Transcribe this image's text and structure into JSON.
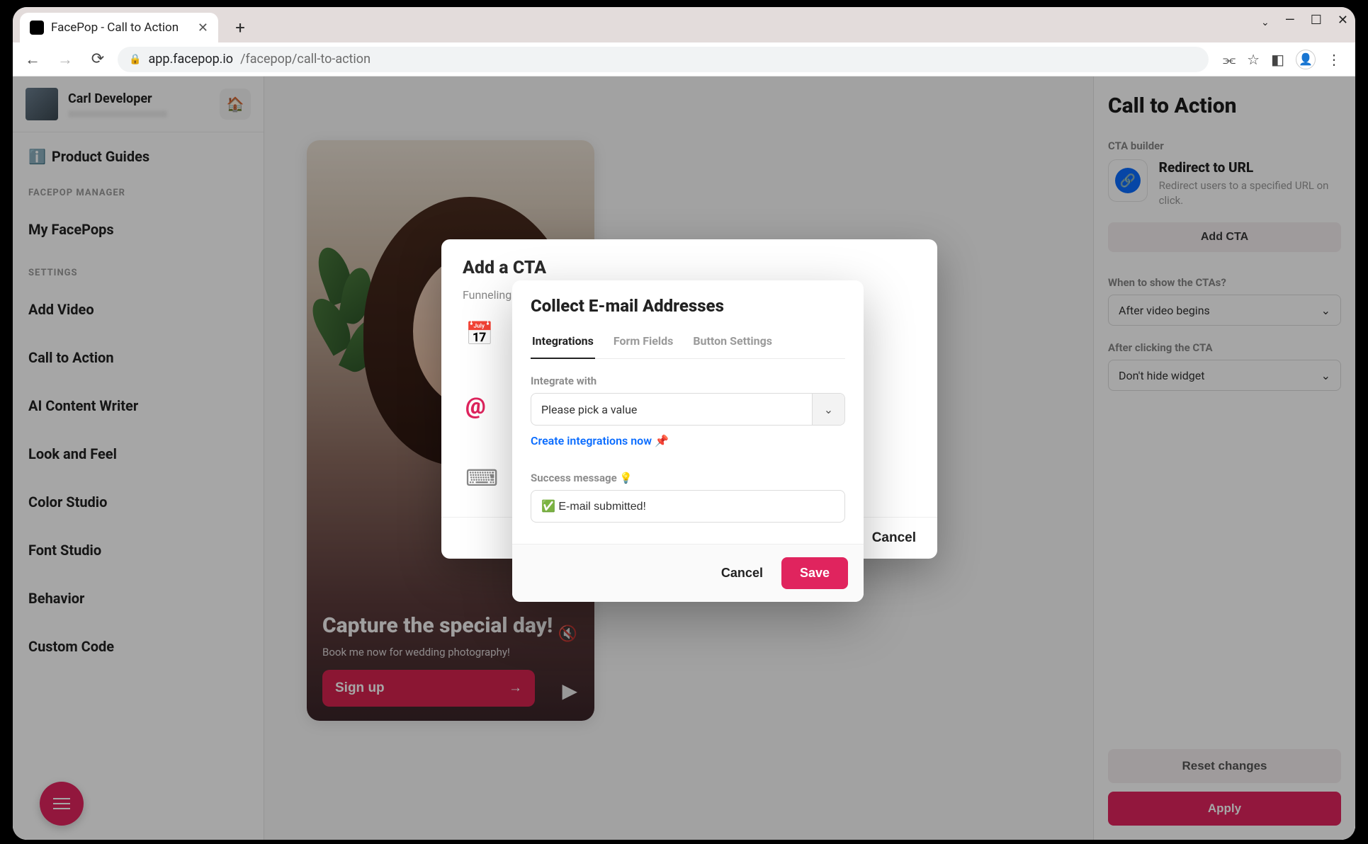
{
  "browser": {
    "tab_title": "FacePop - Call to Action",
    "url_host": "app.facepop.io",
    "url_path": "/facepop/call-to-action"
  },
  "sidebar": {
    "user_name": "Carl Developer",
    "product_guides_label": "Product Guides",
    "product_guides_icon": "ℹ️",
    "section_manager": "FACEPOP MANAGER",
    "my_facepops": "My FacePops",
    "section_settings": "SETTINGS",
    "items": [
      "Add Video",
      "Call to Action",
      "AI Content Writer",
      "Look and Feel",
      "Color Studio",
      "Font Studio",
      "Behavior",
      "Custom Code"
    ]
  },
  "preview": {
    "title": "Capture the special day!",
    "subtitle": "Book me now for wedding photography!",
    "signup_label": "Sign up"
  },
  "right_panel": {
    "title": "Call to Action",
    "builder_label": "CTA builder",
    "cta_title": "Redirect to URL",
    "cta_sub": "Redirect users to a specified URL on click.",
    "add_cta": "Add CTA",
    "when_label": "When to show the CTAs?",
    "when_value": "After video begins",
    "after_label": "After clicking the CTA",
    "after_value": "Don't hide widget",
    "reset": "Reset changes",
    "apply": "Apply"
  },
  "outer_modal": {
    "title": "Add a CTA",
    "subtitle": "Funneling",
    "cancel": "Cancel",
    "icons": [
      "📅",
      "@",
      "⌨"
    ]
  },
  "inner_modal": {
    "title": "Collect E-mail Addresses",
    "tabs": [
      "Integrations",
      "Form Fields",
      "Button Settings"
    ],
    "active_tab_index": 0,
    "integrate_label": "Integrate with",
    "integrate_placeholder": "Please pick a value",
    "create_link": "Create integrations now",
    "create_link_icon": "📌",
    "success_label": "Success message 💡",
    "success_value": "✅ E-mail submitted!",
    "cancel": "Cancel",
    "save": "Save"
  }
}
